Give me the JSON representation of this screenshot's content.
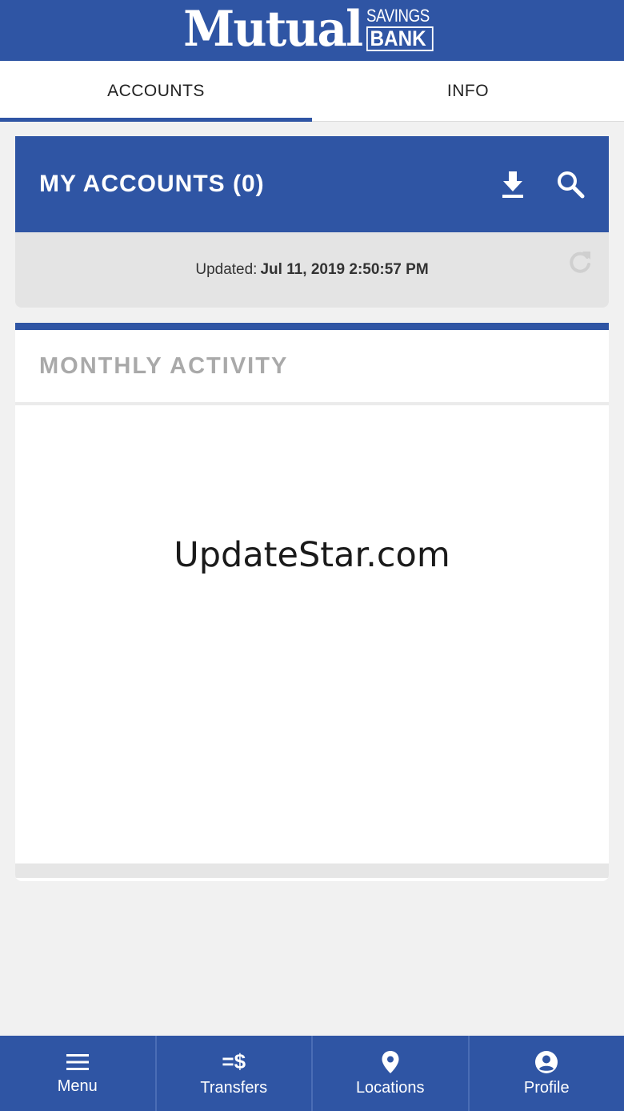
{
  "brand": {
    "name_main": "Mutual",
    "name_top": "SAVINGS",
    "name_bottom": "BANK"
  },
  "tabs": [
    {
      "label": "ACCOUNTS",
      "active": true
    },
    {
      "label": "INFO",
      "active": false
    }
  ],
  "accounts": {
    "title": "MY ACCOUNTS (0)",
    "updated_label": "Updated:",
    "updated_value": "Jul 11, 2019 2:50:57 PM",
    "icons": [
      "download-icon",
      "search-icon",
      "refresh-icon"
    ]
  },
  "activity": {
    "title": "MONTHLY ACTIVITY",
    "watermark": "UpdateStar.com"
  },
  "bottom_nav": [
    {
      "label": "Menu",
      "icon": "menu-icon"
    },
    {
      "label": "Transfers",
      "icon": "transfers-icon"
    },
    {
      "label": "Locations",
      "icon": "location-pin-icon"
    },
    {
      "label": "Profile",
      "icon": "profile-icon"
    }
  ],
  "colors": {
    "primary": "#2f55a4",
    "background": "#f1f1f1",
    "muted_text": "#a9a9a9"
  }
}
